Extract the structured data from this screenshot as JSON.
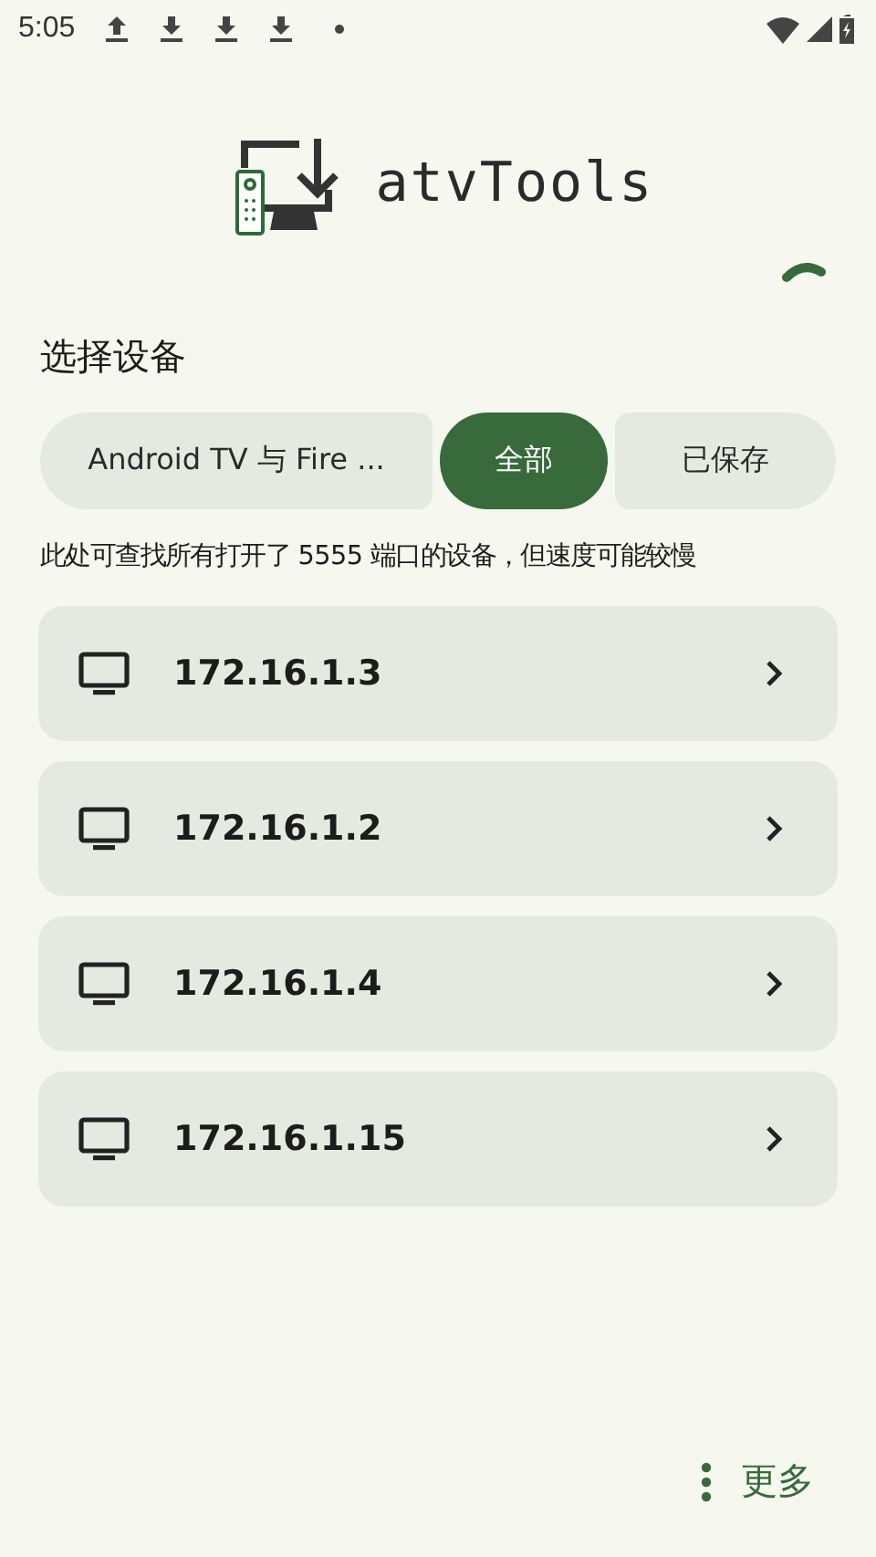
{
  "status_bar": {
    "time": "5:05",
    "notifications": [
      {
        "kind": "upload"
      },
      {
        "kind": "download"
      },
      {
        "kind": "download"
      },
      {
        "kind": "download"
      },
      {
        "kind": "dot"
      }
    ]
  },
  "app": {
    "name": "atvTools"
  },
  "section": {
    "title": "选择设备",
    "loading": true
  },
  "filters": [
    {
      "label": "Android TV 与 Fire ...",
      "selected": false
    },
    {
      "label": "全部",
      "selected": true
    },
    {
      "label": "已保存",
      "selected": false
    }
  ],
  "hint": "此处可查找所有打开了 5555 端口的设备，但速度可能较慢",
  "devices": [
    {
      "address": "172.16.1.3"
    },
    {
      "address": "172.16.1.2"
    },
    {
      "address": "172.16.1.4"
    },
    {
      "address": "172.16.1.15"
    }
  ],
  "more_button": {
    "label": "更多"
  }
}
